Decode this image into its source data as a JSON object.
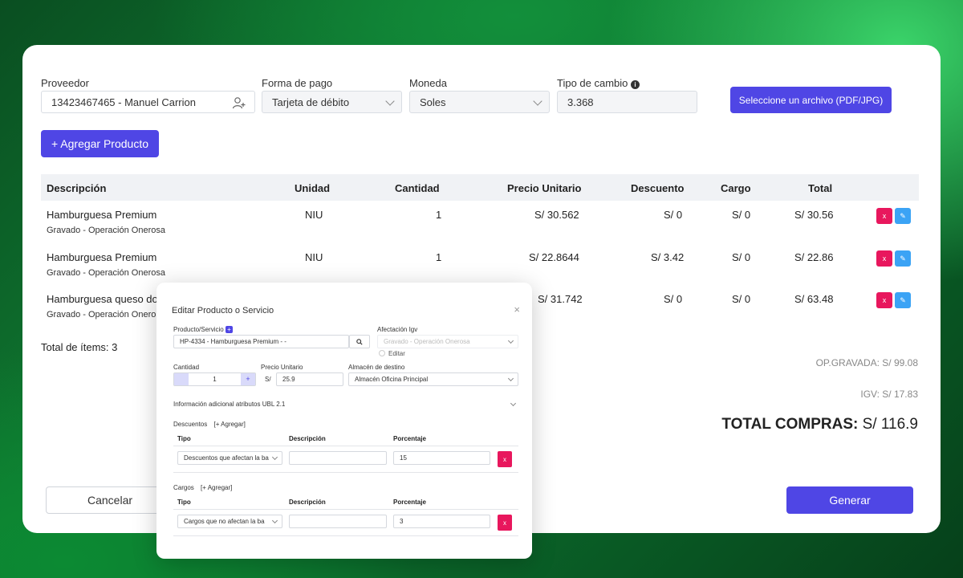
{
  "form": {
    "proveedor_label": "Proveedor",
    "proveedor_value": "13423467465 - Manuel Carrion",
    "forma_pago_label": "Forma de pago",
    "forma_pago_value": "Tarjeta de débito",
    "moneda_label": "Moneda",
    "moneda_value": "Soles",
    "tipo_cambio_label": "Tipo de cambio",
    "tipo_cambio_value": "3.368",
    "file_button": "Seleccione un archivo (PDF/JPG)",
    "add_product_button": "+ Agregar Producto"
  },
  "table": {
    "headers": [
      "Descripción",
      "Unidad",
      "Cantidad",
      "Precio Unitario",
      "Descuento",
      "Cargo",
      "Total"
    ],
    "rows": [
      {
        "name": "Hamburguesa Premium",
        "sub": "Gravado - Operación Onerosa",
        "unit": "NIU",
        "qty": "1",
        "price": "S/ 30.562",
        "discount": "S/ 0",
        "charge": "S/ 0",
        "total": "S/ 30.56"
      },
      {
        "name": "Hamburguesa Premium",
        "sub": "Gravado - Operación Onerosa",
        "unit": "NIU",
        "qty": "1",
        "price": "S/ 22.8644",
        "discount": "S/ 3.42",
        "charge": "S/ 0",
        "total": "S/ 22.86"
      },
      {
        "name": "Hamburguesa queso do",
        "sub": "Gravado - Operación Onero",
        "unit": "",
        "qty": "",
        "price": "S/ 31.742",
        "discount": "S/ 0",
        "charge": "S/ 0",
        "total": "S/ 63.48"
      }
    ],
    "delete_label": "x",
    "edit_label": "✎"
  },
  "summary": {
    "items_total": "Total de ítems: 3",
    "op_gravada": "OP.GRAVADA: S/ 99.08",
    "igv": "IGV: S/ 17.83",
    "total_label": "TOTAL COMPRAS:",
    "total_value": "S/ 116.9"
  },
  "footer": {
    "cancel": "Cancelar",
    "generate": "Generar"
  },
  "modal": {
    "title": "Editar Producto o Servicio",
    "close": "×",
    "producto_label": "Producto/Servicio",
    "producto_value": "HP-4334 - Hamburguesa Premium -  -",
    "afectacion_label": "Afectación Igv",
    "afectacion_value": "Gravado - Operación Onerosa",
    "editar_label": "Editar",
    "cantidad_label": "Cantidad",
    "cantidad_value": "1",
    "precio_label": "Precio Unitario",
    "precio_prefix": "S/",
    "precio_value": "25.9",
    "almacen_label": "Almacén de destino",
    "almacen_value": "Almacén Oficina Principal",
    "info_adicional": "Información adicional atributos UBL 2.1",
    "descuentos_label": "Descuentos",
    "descuentos_add": "[+ Agregar]",
    "cargos_label": "Cargos",
    "cargos_add": "[+ Agregar]",
    "col_tipo": "Tipo",
    "col_descripcion": "Descripción",
    "col_porcentaje": "Porcentaje",
    "descuento_tipo": "Descuentos que afectan la ba",
    "descuento_porcentaje": "15",
    "cargo_tipo": "Cargos que no afectan la ba",
    "cargo_porcentaje": "3",
    "remove_label": "x"
  }
}
